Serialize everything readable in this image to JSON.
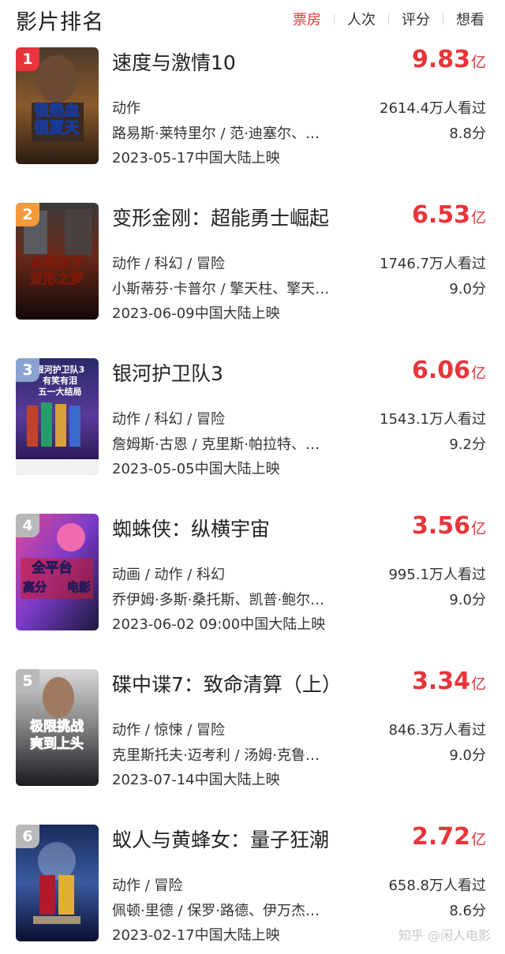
{
  "header": {
    "title": "影片排名",
    "tabs": [
      {
        "label": "票房",
        "active": true
      },
      {
        "label": "人次",
        "active": false
      },
      {
        "label": "评分",
        "active": false
      },
      {
        "label": "想看",
        "active": false
      }
    ]
  },
  "colors": {
    "accent": "#e8343a",
    "rank_1": "#e8343a",
    "rank_2": "#f29a3c",
    "rank_3": "#8aa3cf",
    "rank_other": "#b9b9b9"
  },
  "movies": [
    {
      "rank": "1",
      "title": "速度与激情10",
      "box_value": "9.83",
      "box_unit": "亿",
      "genre": "动作",
      "cast": "路易斯·莱特里尔 / 范·迪塞尔、…",
      "release": "2023-05-17中国大陆上映",
      "viewers": "2614.4万人看过",
      "score": "8.8分",
      "poster_text": [
        "很热血",
        "很夏天"
      ]
    },
    {
      "rank": "2",
      "title": "变形金刚：超能勇士崛起",
      "box_value": "6.53",
      "box_unit": "亿",
      "genre": "动作 / 科幻 / 冒险",
      "cast": "小斯蒂芬·卡普尔 / 擎天柱、擎天…",
      "release": "2023-06-09中国大陆上映",
      "viewers": "1746.7万人看过",
      "score": "9.0分",
      "poster_text": [
        "点燃孩子",
        "变形之梦"
      ]
    },
    {
      "rank": "3",
      "title": "银河护卫队3",
      "box_value": "6.06",
      "box_unit": "亿",
      "genre": "动作 / 科幻 / 冒险",
      "cast": "詹姆斯·古恩 / 克里斯·帕拉特、…",
      "release": "2023-05-05中国大陆上映",
      "viewers": "1543.1万人看过",
      "score": "9.2分",
      "poster_text": [
        "银河护卫队3",
        "有笑有泪",
        "五一大结局"
      ]
    },
    {
      "rank": "4",
      "title": "蜘蛛侠：纵横宇宙",
      "box_value": "3.56",
      "box_unit": "亿",
      "genre": "动画 / 动作 / 科幻",
      "cast": "乔伊姆·多斯·桑托斯、凯普·鲍尔…",
      "release": "2023-06-02 09:00中国大陆上映",
      "viewers": "995.1万人看过",
      "score": "9.0分",
      "poster_text": [
        "全平台",
        "高分",
        "电影"
      ]
    },
    {
      "rank": "5",
      "title": "碟中谍7：致命清算（上）",
      "box_value": "3.34",
      "box_unit": "亿",
      "genre": "动作 / 惊悚 / 冒险",
      "cast": "克里斯托夫·迈考利 / 汤姆·克鲁…",
      "release": "2023-07-14中国大陆上映",
      "viewers": "846.3万人看过",
      "score": "9.0分",
      "poster_text": [
        "极限挑战",
        "爽到上头"
      ]
    },
    {
      "rank": "6",
      "title": "蚁人与黄蜂女：量子狂潮",
      "box_value": "2.72",
      "box_unit": "亿",
      "genre": "动作 / 冒险",
      "cast": "佩顿·里德 / 保罗·路德、伊万杰…",
      "release": "2023-02-17中国大陆上映",
      "viewers": "658.8万人看过",
      "score": "8.6分",
      "poster_text": []
    }
  ],
  "watermark": "知乎 @闲人电影"
}
